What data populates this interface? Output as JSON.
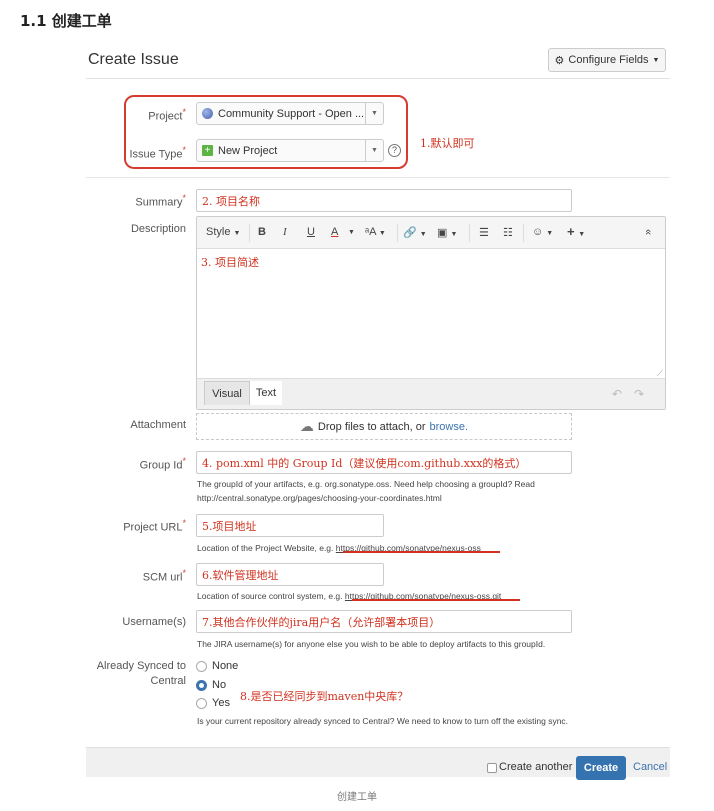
{
  "heading": "1.1 创建工单",
  "dialog": {
    "title": "Create Issue",
    "configure_fields": "Configure Fields"
  },
  "project": {
    "label": "Project",
    "value": "Community Support - Open ..."
  },
  "issue_type": {
    "label": "Issue Type",
    "value": "New Project"
  },
  "annotations": {
    "default": "1.默认即可",
    "summary": "2. 项目名称",
    "description": "3. 项目简述",
    "group_id": "4. pom.xml 中的 Group Id（建议使用com.github.xxx的格式）",
    "project_url": "5.项目地址",
    "scm_url": "6.软件管理地址",
    "usernames": "7.其他合作伙伴的jira用户名（允许部署本项目）",
    "synced": "8.是否已经同步到maven中央库？"
  },
  "summary": {
    "label": "Summary"
  },
  "description": {
    "label": "Description"
  },
  "toolbar": {
    "style": "Style",
    "bold": "B",
    "italic": "I",
    "underline": "U",
    "color": "A",
    "more_format": "ᵃA",
    "link": "🔗",
    "attachment_icon": "▣",
    "bullet": "☰",
    "numbered": "☷",
    "emoji": "☺",
    "plus": "+",
    "collapse": "«"
  },
  "editor_tabs": {
    "visual": "Visual",
    "text": "Text"
  },
  "attachment": {
    "label": "Attachment",
    "drop_text": "Drop files to attach, or",
    "browse": "browse."
  },
  "group_id": {
    "label": "Group Id",
    "hint_line1": "The groupId of your artifacts, e.g. org.sonatype.oss. Need help choosing a groupId? Read",
    "hint_line2": "http://central.sonatype.org/pages/choosing-your-coordinates.html"
  },
  "project_url": {
    "label": "Project URL",
    "hint_prefix": "Location of the Project Website, e.g.",
    "hint_link": "https://github.com/sonatype/nexus-oss"
  },
  "scm_url": {
    "label": "SCM url",
    "hint_prefix": "Location of source control system, e.g.",
    "hint_link": "https://github.com/sonatype/nexus-oss.git"
  },
  "usernames": {
    "label": "Username(s)",
    "hint": "The JIRA username(s) for anyone else you wish to be able to deploy artifacts to this groupId."
  },
  "synced": {
    "label_line1": "Already Synced to",
    "label_line2": "Central",
    "options": [
      "None",
      "No",
      "Yes"
    ],
    "selected": "No",
    "hint": "Is your current repository already synced to Central? We need to know to turn off the existing sync."
  },
  "footer": {
    "create_another": "Create another",
    "create": "Create",
    "cancel": "Cancel"
  },
  "caption": "创建工单",
  "colors": {
    "accent": "#3572b0",
    "annotation_red": "#d0321f"
  }
}
